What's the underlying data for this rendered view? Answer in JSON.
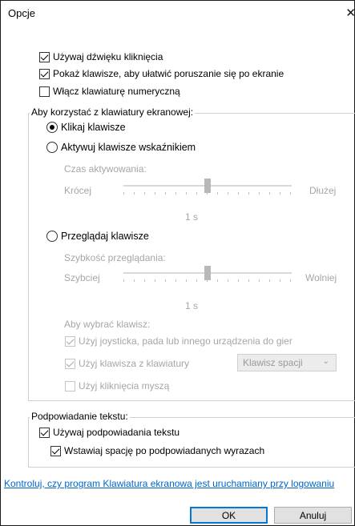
{
  "window": {
    "title": "Opcje",
    "close_glyph": "✕"
  },
  "top_options": [
    {
      "label": "Używaj dźwięku kliknięcia",
      "checked": true
    },
    {
      "label": "Pokaż klawisze, aby ułatwić poruszanie się po ekranie",
      "checked": true
    },
    {
      "label": "Włącz klawiaturę numeryczną",
      "checked": false
    }
  ],
  "keyboard_group": {
    "legend": "Aby korzystać z klawiatury ekranowej:",
    "radio_click": "Klikaj klawisze",
    "radio_hover": "Aktywuj klawisze wskaźnikiem",
    "hover_time_label": "Czas aktywowania:",
    "hover_short": "Krócej",
    "hover_long": "Dłużej",
    "hover_value": "1 s",
    "hover_level": 0.5,
    "radio_scan": "Przeglądaj klawisze",
    "scan_speed_label": "Szybkość przeglądania:",
    "scan_fast": "Szybciej",
    "scan_slow": "Wolniej",
    "scan_value": "1 s",
    "scan_level": 0.5,
    "select_key_label": "Aby wybrać klawisz:",
    "select_options": [
      {
        "label": "Użyj joysticka, pada lub innego urządzenia do gier",
        "checked": true
      },
      {
        "label": "Użyj klawisza z klawiatury",
        "checked": true
      },
      {
        "label": "Użyj kliknięcia myszą",
        "checked": false
      }
    ],
    "key_combo_value": "Klawisz spacji"
  },
  "prediction_group": {
    "legend": "Podpowiadanie tekstu:",
    "use_prediction": "Używaj podpowiadania tekstu",
    "insert_space": "Wstawiaj spację po podpowiadanych wyrazach"
  },
  "login_link": "Kontroluj, czy program Klawiatura ekranowa jest uruchamiany przy logowaniu",
  "buttons": {
    "ok": "OK",
    "cancel": "Anuluj"
  },
  "colors": {
    "accent": "#0078d7",
    "link": "#0066cc",
    "disabled_text": "#a6a6a6"
  }
}
